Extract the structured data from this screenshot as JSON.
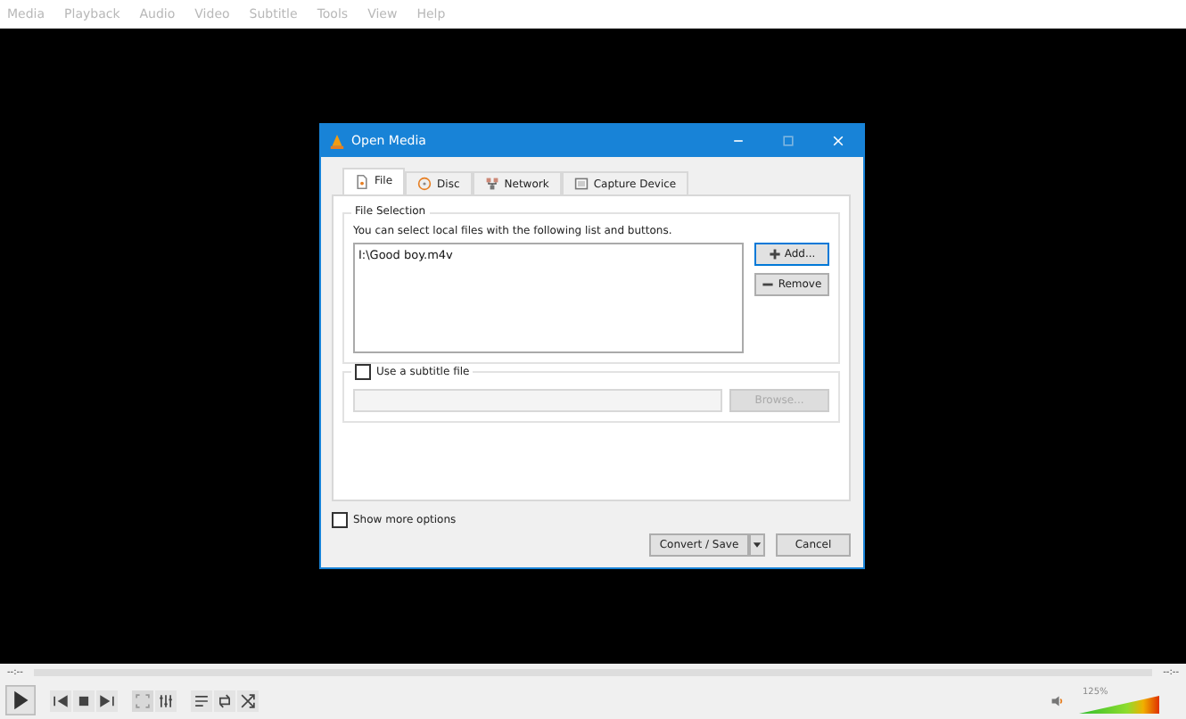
{
  "menu": [
    "Media",
    "Playback",
    "Audio",
    "Video",
    "Subtitle",
    "Tools",
    "View",
    "Help"
  ],
  "dialog": {
    "title": "Open Media",
    "tabs": [
      {
        "label": "File",
        "selected": true
      },
      {
        "label": "Disc",
        "selected": false
      },
      {
        "label": "Network",
        "selected": false
      },
      {
        "label": "Capture Device",
        "selected": false
      }
    ],
    "file_selection": {
      "title": "File Selection",
      "hint": "You can select local files with the following list and buttons.",
      "files": [
        "I:\\Good boy.m4v"
      ],
      "add": "Add...",
      "remove": "Remove"
    },
    "subtitle": {
      "label": "Use a subtitle file",
      "checked": false,
      "browse": "Browse...",
      "disabled": true
    },
    "show_more": {
      "label": "Show more options",
      "checked": false
    },
    "convert": "Convert / Save",
    "cancel": "Cancel"
  },
  "player": {
    "elapsed": "--:--",
    "remaining": "--:--",
    "volume": {
      "reading": "125%",
      "level": 1
    }
  }
}
